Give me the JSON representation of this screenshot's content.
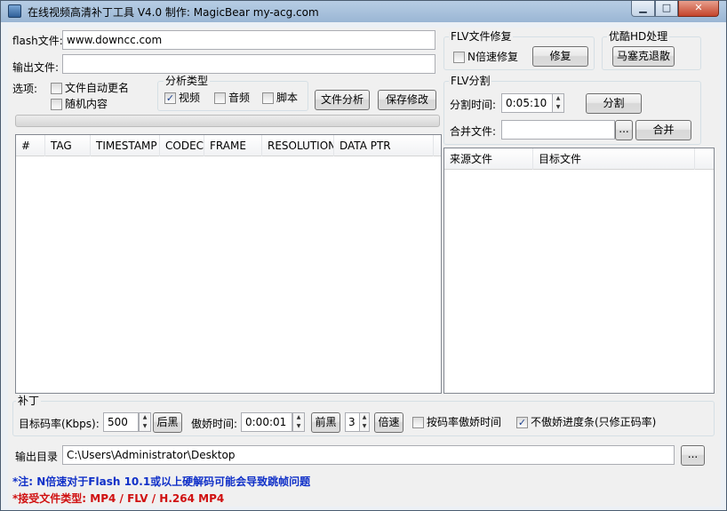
{
  "window": {
    "title": "在线视频高清补丁工具 V4.0   制作: MagicBear  my-acg.com",
    "min_glyph": "▁",
    "max_glyph": "□",
    "close_glyph": "✕"
  },
  "flash": {
    "label": "flash文件:",
    "value": "www.downcc.com",
    "output_label": "输出文件:",
    "output_value": ""
  },
  "options": {
    "label": "选项:",
    "auto_rename": "文件自动更名",
    "random_content": "随机内容"
  },
  "analysis": {
    "group_label": "分析类型",
    "video": "视频",
    "audio": "音频",
    "script": "脚本",
    "analyze_button": "文件分析",
    "save_button": "保存修改"
  },
  "table": {
    "columns": [
      "#",
      "TAG",
      "TIMESTAMP",
      "CODEC",
      "FRAME",
      "RESOLUTION",
      "DATA PTR"
    ]
  },
  "flv_repair": {
    "group_label": "FLV文件修复",
    "nx_repair": "N倍速修复",
    "repair_button": "修复"
  },
  "youku": {
    "group_label": "优酷HD处理",
    "button": "马塞克退散"
  },
  "flv_split": {
    "group_label": "FLV分割",
    "split_time_label": "分割时间:",
    "split_time_value": "0:05:10",
    "split_button": "分割",
    "merge_label": "合并文件:",
    "browse_button": "...",
    "merge_button": "合并",
    "columns": [
      "来源文件",
      "目标文件"
    ]
  },
  "patch": {
    "group_label": "补丁",
    "bitrate_label": "目标码率(Kbps):",
    "bitrate_value": "500",
    "post_black_button": "后黑",
    "arrogant_time_label": "傲娇时间:",
    "arrogant_time_value": "0:00:01",
    "pre_black_button": "前黑",
    "speed_value": "3",
    "speed_button": "倍速",
    "by_bitrate_label": "按码率傲娇时间",
    "no_progress_label": "不傲娇进度条(只修正码率)"
  },
  "output": {
    "label": "输出目录",
    "value": "C:\\Users\\Administrator\\Desktop",
    "browse_button": "..."
  },
  "notes": {
    "note1": "*注: N倍速对于Flash 10.1或以上硬解码可能会导致跳帧问题",
    "note2": "*接受文件类型: MP4 / FLV / H.264 MP4"
  },
  "colors": {
    "note1": "#1030c8",
    "note2": "#d01010"
  },
  "checkbox_states": {
    "auto_rename": false,
    "random_content": false,
    "video": true,
    "audio": false,
    "script": false,
    "nx_repair": false,
    "by_bitrate": false,
    "no_progress": true
  },
  "check_glyph": "✓"
}
